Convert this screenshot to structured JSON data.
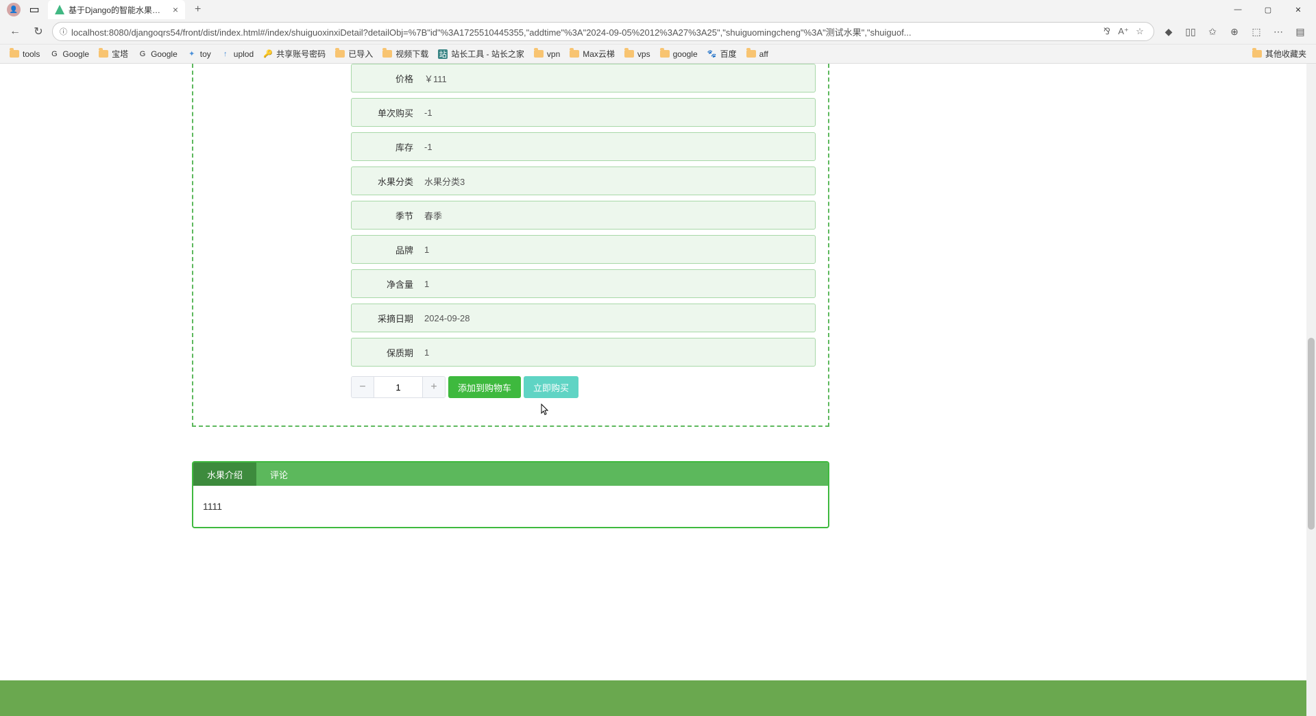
{
  "browser": {
    "tab_title": "基于Django的智能水果销售系统",
    "url": "localhost:8080/djangoqrs54/front/dist/index.html#/index/shuiguoxinxiDetail?detailObj=%7B\"id\"%3A1725510445355,\"addtime\"%3A\"2024-09-05%2012%3A27%3A25\",\"shuiguomingcheng\"%3A\"测试水果\",\"shuiguof..."
  },
  "bookmarks": {
    "tools": "tools",
    "google1": "Google",
    "baota": "宝塔",
    "google2": "Google",
    "toy": "toy",
    "uplod": "uplod",
    "share_pwd": "共享账号密码",
    "imported": "已导入",
    "video_dl": "视频下载",
    "zhanzhang": "站长工具 - 站长之家",
    "vpn": "vpn",
    "max": "Max云梯",
    "vps": "vps",
    "google3": "google",
    "baidu": "百度",
    "aff": "aff",
    "other": "其他收藏夹"
  },
  "detail": {
    "rows": [
      {
        "label": "价格",
        "value": "￥111"
      },
      {
        "label": "单次购买",
        "value": "-1"
      },
      {
        "label": "库存",
        "value": "-1"
      },
      {
        "label": "水果分类",
        "value": "水果分类3"
      },
      {
        "label": "季节",
        "value": "春季"
      },
      {
        "label": "品牌",
        "value": "1"
      },
      {
        "label": "净含量",
        "value": "1"
      },
      {
        "label": "采摘日期",
        "value": "2024-09-28"
      },
      {
        "label": "保质期",
        "value": "1"
      }
    ],
    "quantity": "1",
    "add_cart": "添加到购物车",
    "buy_now": "立即购买"
  },
  "tabs": {
    "intro": "水果介绍",
    "comment": "评论",
    "content": "1111"
  }
}
